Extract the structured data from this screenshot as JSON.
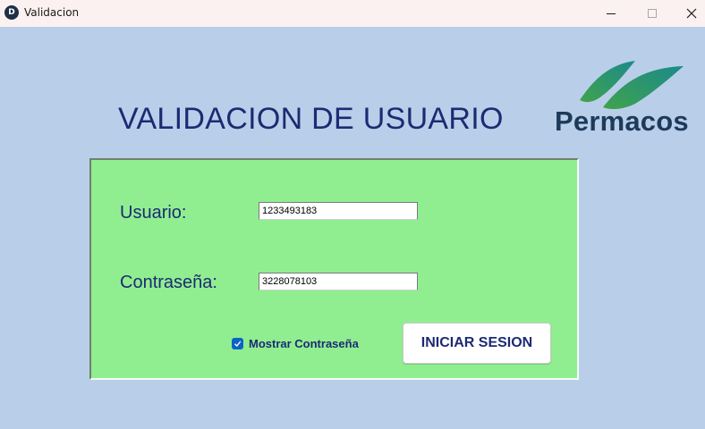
{
  "window": {
    "title": "Validacion",
    "icon_letter": "D",
    "icon_name": "app-icon"
  },
  "heading": "VALIDACION DE USUARIO",
  "logo": {
    "wordmark": "Permacos",
    "colors": {
      "wave_green": "#3fa34d",
      "wave_teal": "#1c8a8a",
      "text": "#1e3a5b"
    }
  },
  "form": {
    "user_label": "Usuario:",
    "user_value": "1233493183",
    "password_label": "Contraseña:",
    "password_value": "3228078103",
    "show_password_label": "Mostrar Contraseña",
    "show_password_checked": true,
    "login_label": "INICIAR SESION"
  },
  "colors": {
    "background": "#b9cfe9",
    "panel": "#90ee90",
    "text_accent": "#1d2a73",
    "checkbox": "#0b63c8"
  }
}
